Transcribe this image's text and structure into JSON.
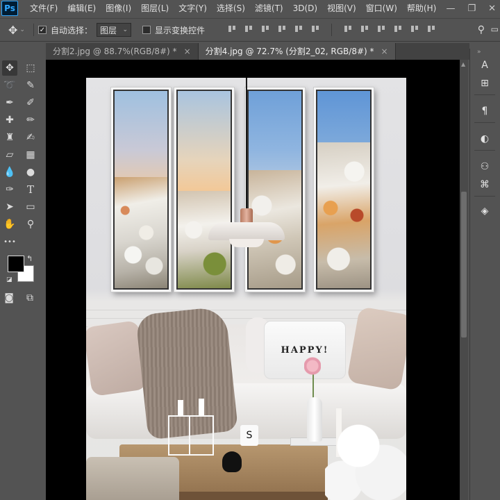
{
  "app": {
    "logo": "Ps"
  },
  "menu": [
    "文件(F)",
    "编辑(E)",
    "图像(I)",
    "图层(L)",
    "文字(Y)",
    "选择(S)",
    "滤镜(T)",
    "3D(D)",
    "视图(V)",
    "窗口(W)",
    "帮助(H)"
  ],
  "window_controls": {
    "minimize": "—",
    "restore": "❐",
    "close": "✕"
  },
  "options": {
    "auto_select_label": "自动选择：",
    "auto_select_checked": true,
    "layer_select_value": "图层",
    "show_transform_label": "显示变换控件",
    "show_transform_checked": false
  },
  "tabs": [
    {
      "label": "分割2.jpg @ 88.7%(RGB/8#) *",
      "close": "×",
      "active": false
    },
    {
      "label": "分割4.jpg @ 72.7% (分割2_02, RGB/8#) *",
      "close": "×",
      "active": true
    }
  ],
  "tools": [
    "move-icon",
    "marquee-icon",
    "lasso-icon",
    "quick-select-icon",
    "pen-brush-icon",
    "eyedropper-icon",
    "healing-icon",
    "brush-icon",
    "stamp-icon",
    "history-brush-icon",
    "eraser-icon",
    "gradient-icon",
    "blur-icon",
    "dodge-icon",
    "pen-icon",
    "type-icon",
    "path-select-icon",
    "rectangle-icon",
    "hand-icon",
    "zoom-icon",
    "more-icon"
  ],
  "tool_glyphs": {
    "move-icon": "✥",
    "marquee-icon": "⬚",
    "lasso-icon": "➰",
    "quick-select-icon": "✎",
    "pen-brush-icon": "✒",
    "eyedropper-icon": "✐",
    "healing-icon": "✚",
    "brush-icon": "✏",
    "stamp-icon": "♜",
    "history-brush-icon": "✍",
    "eraser-icon": "▱",
    "gradient-icon": "▦",
    "blur-icon": "💧",
    "dodge-icon": "●",
    "pen-icon": "✑",
    "type-icon": "T",
    "path-select-icon": "➤",
    "rectangle-icon": "▭",
    "hand-icon": "✋",
    "zoom-icon": "⚲",
    "more-icon": "•••"
  },
  "colors": {
    "foreground": "#000000",
    "background": "#ffffff",
    "ui_panel": "#535353",
    "tab_bar": "#424242",
    "accent": "#31a8ff"
  },
  "canvas": {
    "pillow_text": "HAPPY!",
    "mug_letter": "S"
  },
  "dock": [
    {
      "icon": "character-icon",
      "glyph": "A"
    },
    {
      "icon": "paragraph-styles-icon",
      "glyph": "⊞"
    },
    {
      "icon": "paragraph-icon",
      "glyph": "¶"
    },
    {
      "icon": "adjustments-icon",
      "glyph": "◐"
    },
    {
      "icon": "channels-icon",
      "glyph": "⚇"
    },
    {
      "icon": "paths-icon",
      "glyph": "⌘"
    },
    {
      "icon": "layers-icon",
      "glyph": "◈"
    }
  ]
}
